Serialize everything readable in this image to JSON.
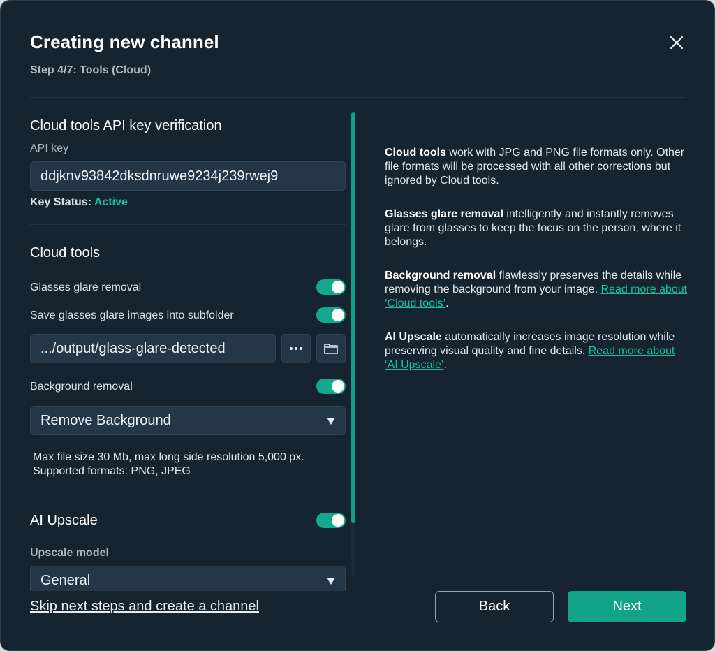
{
  "header": {
    "title": "Creating new channel",
    "step": "Step 4/7: Tools (Cloud)"
  },
  "api": {
    "section_title": "Cloud tools API key verification",
    "key_label": "API key",
    "key_value": "ddjknv93842dksdnruwe9234j239rwej9",
    "status_label": "Key Status:",
    "status_value": "Active",
    "status_color": "#19c2a0"
  },
  "cloud_tools": {
    "section_title": "Cloud tools",
    "glasses_label": "Glasses glare removal",
    "glasses_on": true,
    "save_subfolder_label": "Save glasses glare images into subfolder",
    "save_subfolder_on": true,
    "folder_path": ".../output/glass-glare-detected",
    "more_icon": "more-horizontal-icon",
    "folder_icon": "folder-icon",
    "bg_label": "Background removal",
    "bg_on": true,
    "bg_select_value": "Remove Background",
    "help_line1": "Max file size 30 Mb, max long side resolution 5,000 px.",
    "help_line2": "Supported formats: PNG, JPEG"
  },
  "upscale": {
    "section_title": "AI Upscale",
    "on": true,
    "model_label": "Upscale model",
    "model_value": "General"
  },
  "info": {
    "p1_bold": "Cloud tools",
    "p1_text": " work with JPG and PNG file formats only. Other file formats will be processed with all other corrections but ignored by Cloud tools.",
    "p2_bold": "Glasses glare removal",
    "p2_text": " intelligently and instantly removes glare from glasses to keep the focus on the person, where it belongs.",
    "p3_bold": "Background removal",
    "p3_text": " flawlessly preserves the details while removing the background from your image. ",
    "p3_link": "Read more about ‘Cloud tools’",
    "p3_end": ".",
    "p4_bold": "AI Upscale",
    "p4_text": " automatically increases image resolution while preserving visual quality and fine details. ",
    "p4_link": "Read more about ‘AI Upscale’",
    "p4_end": "."
  },
  "footer": {
    "skip_label": "Skip next steps and create a channel",
    "back_label": "Back",
    "next_label": "Next"
  },
  "colors": {
    "accent": "#13a488",
    "background": "#16242f",
    "field": "#233746"
  }
}
